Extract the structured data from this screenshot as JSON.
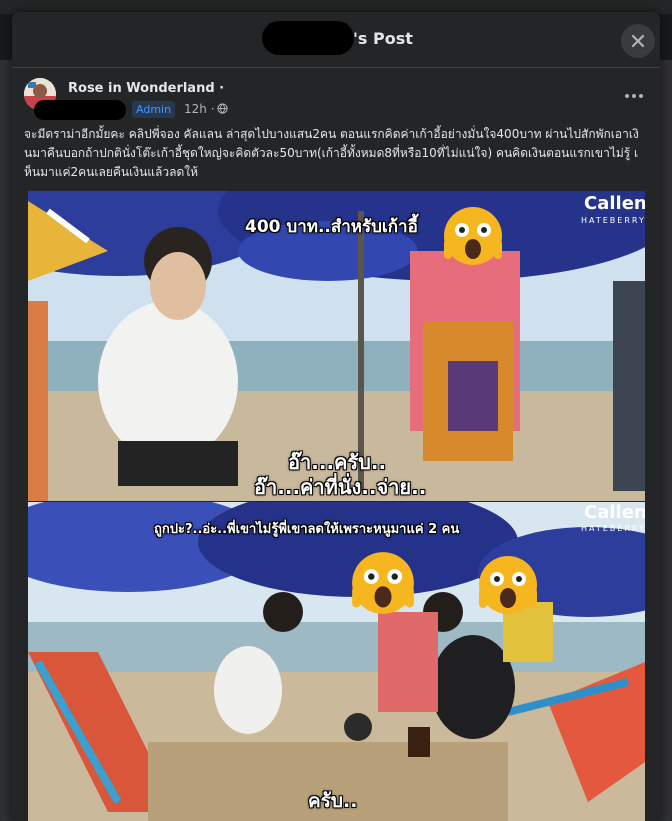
{
  "modal": {
    "title_suffix": "'s Post",
    "close_icon": "close-icon"
  },
  "post": {
    "author": "Rose in Wonderland ·",
    "badge": "Admin",
    "time": "12h ·",
    "privacy_icon": "globe-icon",
    "more_icon": "more-horizontal-icon",
    "caption": "จะมีดราม่าอีกมั้ยคะ คลิปพี่จอง คัลแลน ล่าสุดไปบางแสน2คน ตอนแรกคิดค่าเก้าอี้อย่างมั่นใจ400บาท ผ่านไปสักพักเอาเงินมาคืนบอกถ้าปกตินั่งโต๊ะเก้าอี้ชุดใหญ่จะคิดตัวละ50บาท(เก้าอี้ทั้งหมด8ที่หรือ10ที่ไม่แน่ใจ) คนคิดเงินตอนแรกเขาไม่รู้ เห็นมาแค่2คนเลยคืนเงินแล้วลดให้"
  },
  "photo1": {
    "top_subtitle": "400 บาท..สำหรับเก้าอี้",
    "brand": "Callen",
    "brand_sub": "HATEBERRY",
    "subtitle_1": "อ๊า...ครับ..",
    "subtitle_2": "อ๊า...ค่าที่นั่ง..จ่าย.."
  },
  "photo2": {
    "top_subtitle": "ถูกปะ?..อ่ะ..พี่เขาไม่รู้พี่เขาลดให้เพราะหนูมาแค่ 2 คน",
    "brand": "Callen",
    "brand_sub": "HATEBERRY",
    "bottom_subtitle": "ครับ.."
  },
  "colors": {
    "modal_bg": "#242526",
    "badge_bg": "#263951",
    "badge_text": "#4599ff",
    "umbrella_blue": "#2c3d9c",
    "emoji_yellow": "#f6b61f"
  }
}
